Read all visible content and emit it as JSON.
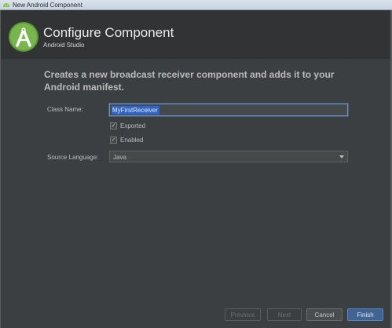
{
  "window": {
    "title": "New Android Component"
  },
  "header": {
    "title": "Configure Component",
    "subtitle": "Android Studio",
    "logo_icon": "android-studio-logo-icon"
  },
  "form": {
    "description": "Creates a new broadcast receiver component and adds it to your Android manifest.",
    "class_name_label": "Class Name:",
    "class_name_value": "MyFirstReceiver",
    "exported_label": "Exported",
    "exported_checked": true,
    "enabled_label": "Enabled",
    "enabled_checked": true,
    "source_language_label": "Source Language:",
    "source_language_value": "Java"
  },
  "buttons": {
    "previous": "Previous",
    "next": "Next",
    "cancel": "Cancel",
    "finish": "Finish"
  },
  "colors": {
    "background": "#3c3f41",
    "header_bg": "#313335",
    "accent": "#4a8f3f",
    "selection": "#2f65ca",
    "finish_button": "#3f6494"
  }
}
